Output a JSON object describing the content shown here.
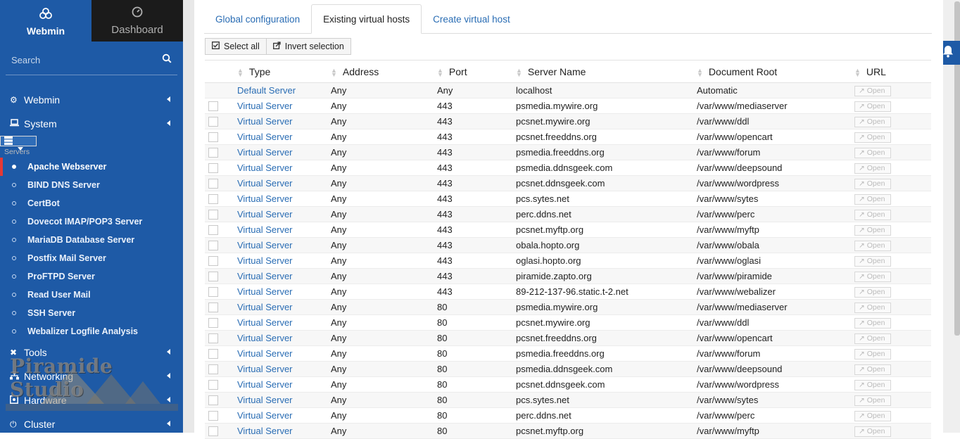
{
  "sidebar": {
    "webmin_label": "Webmin",
    "dashboard_label": "Dashboard",
    "search_placeholder": "Search",
    "menu": [
      {
        "label": "Webmin"
      },
      {
        "label": "System"
      },
      {
        "label": "Servers"
      }
    ],
    "servers_sub": [
      {
        "label": "Apache Webserver"
      },
      {
        "label": "BIND DNS Server"
      },
      {
        "label": "CertBot"
      },
      {
        "label": "Dovecot IMAP/POP3 Server"
      },
      {
        "label": "MariaDB Database Server"
      },
      {
        "label": "Postfix Mail Server"
      },
      {
        "label": "ProFTPD Server"
      },
      {
        "label": "Read User Mail"
      },
      {
        "label": "SSH Server"
      },
      {
        "label": "Webalizer Logfile Analysis"
      }
    ],
    "menu_after": [
      {
        "label": "Tools"
      },
      {
        "label": "Networking"
      },
      {
        "label": "Hardware"
      },
      {
        "label": "Cluster"
      }
    ],
    "watermark_text": "Piramide Studio"
  },
  "tabs": [
    {
      "label": "Global configuration"
    },
    {
      "label": "Existing virtual hosts"
    },
    {
      "label": "Create virtual host"
    }
  ],
  "buttons": {
    "select_all": "Select all",
    "invert_selection": "Invert selection"
  },
  "table": {
    "headers": [
      "Type",
      "Address",
      "Port",
      "Server Name",
      "Document Root",
      "URL"
    ],
    "open_label": "Open",
    "rows": [
      {
        "type": "Default Server",
        "address": "Any",
        "port": "Any",
        "server": "localhost",
        "root": "Automatic",
        "checkbox": false
      },
      {
        "type": "Virtual Server",
        "address": "Any",
        "port": "443",
        "server": "psmedia.mywire.org",
        "root": "/var/www/mediaserver",
        "checkbox": true
      },
      {
        "type": "Virtual Server",
        "address": "Any",
        "port": "443",
        "server": "pcsnet.mywire.org",
        "root": "/var/www/ddl",
        "checkbox": true
      },
      {
        "type": "Virtual Server",
        "address": "Any",
        "port": "443",
        "server": "pcsnet.freeddns.org",
        "root": "/var/www/opencart",
        "checkbox": true
      },
      {
        "type": "Virtual Server",
        "address": "Any",
        "port": "443",
        "server": "psmedia.freeddns.org",
        "root": "/var/www/forum",
        "checkbox": true
      },
      {
        "type": "Virtual Server",
        "address": "Any",
        "port": "443",
        "server": "psmedia.ddnsgeek.com",
        "root": "/var/www/deepsound",
        "checkbox": true
      },
      {
        "type": "Virtual Server",
        "address": "Any",
        "port": "443",
        "server": "pcsnet.ddnsgeek.com",
        "root": "/var/www/wordpress",
        "checkbox": true
      },
      {
        "type": "Virtual Server",
        "address": "Any",
        "port": "443",
        "server": "pcs.sytes.net",
        "root": "/var/www/sytes",
        "checkbox": true
      },
      {
        "type": "Virtual Server",
        "address": "Any",
        "port": "443",
        "server": "perc.ddns.net",
        "root": "/var/www/perc",
        "checkbox": true
      },
      {
        "type": "Virtual Server",
        "address": "Any",
        "port": "443",
        "server": "pcsnet.myftp.org",
        "root": "/var/www/myftp",
        "checkbox": true
      },
      {
        "type": "Virtual Server",
        "address": "Any",
        "port": "443",
        "server": "obala.hopto.org",
        "root": "/var/www/obala",
        "checkbox": true
      },
      {
        "type": "Virtual Server",
        "address": "Any",
        "port": "443",
        "server": "oglasi.hopto.org",
        "root": "/var/www/oglasi",
        "checkbox": true
      },
      {
        "type": "Virtual Server",
        "address": "Any",
        "port": "443",
        "server": "piramide.zapto.org",
        "root": "/var/www/piramide",
        "checkbox": true
      },
      {
        "type": "Virtual Server",
        "address": "Any",
        "port": "443",
        "server": "89-212-137-96.static.t-2.net",
        "root": "/var/www/webalizer",
        "checkbox": true
      },
      {
        "type": "Virtual Server",
        "address": "Any",
        "port": "80",
        "server": "psmedia.mywire.org",
        "root": "/var/www/mediaserver",
        "checkbox": true
      },
      {
        "type": "Virtual Server",
        "address": "Any",
        "port": "80",
        "server": "pcsnet.mywire.org",
        "root": "/var/www/ddl",
        "checkbox": true
      },
      {
        "type": "Virtual Server",
        "address": "Any",
        "port": "80",
        "server": "pcsnet.freeddns.org",
        "root": "/var/www/opencart",
        "checkbox": true
      },
      {
        "type": "Virtual Server",
        "address": "Any",
        "port": "80",
        "server": "psmedia.freeddns.org",
        "root": "/var/www/forum",
        "checkbox": true
      },
      {
        "type": "Virtual Server",
        "address": "Any",
        "port": "80",
        "server": "psmedia.ddnsgeek.com",
        "root": "/var/www/deepsound",
        "checkbox": true
      },
      {
        "type": "Virtual Server",
        "address": "Any",
        "port": "80",
        "server": "pcsnet.ddnsgeek.com",
        "root": "/var/www/wordpress",
        "checkbox": true
      },
      {
        "type": "Virtual Server",
        "address": "Any",
        "port": "80",
        "server": "pcs.sytes.net",
        "root": "/var/www/sytes",
        "checkbox": true
      },
      {
        "type": "Virtual Server",
        "address": "Any",
        "port": "80",
        "server": "perc.ddns.net",
        "root": "/var/www/perc",
        "checkbox": true
      },
      {
        "type": "Virtual Server",
        "address": "Any",
        "port": "80",
        "server": "pcsnet.myftp.org",
        "root": "/var/www/myftp",
        "checkbox": true
      }
    ]
  }
}
